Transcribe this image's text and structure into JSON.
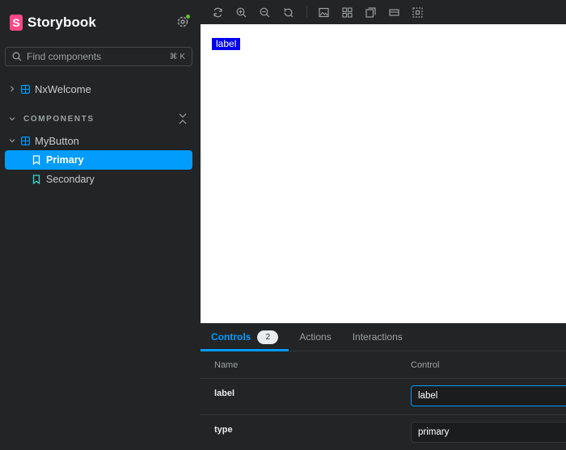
{
  "brand": {
    "name": "Storybook",
    "logo_letter": "S",
    "color": "#ff4785"
  },
  "sidebar": {
    "search_placeholder": "Find components",
    "search_shortcut": "⌘ K",
    "top_item": {
      "label": "NxWelcome"
    },
    "section_label": "COMPONENTS",
    "component": {
      "label": "MyButton"
    },
    "stories": [
      {
        "label": "Primary",
        "selected": true
      },
      {
        "label": "Secondary",
        "selected": false
      }
    ],
    "accent_color": "#029cfd"
  },
  "toolbar": {
    "icons": [
      "reload-icon",
      "zoom-in-icon",
      "zoom-out-icon",
      "zoom-reset-icon",
      "background-icon",
      "grid-icon",
      "viewport-icon",
      "measure-icon",
      "outline-icon"
    ]
  },
  "preview": {
    "button_label": "label"
  },
  "addons": {
    "tabs": [
      {
        "label": "Controls",
        "badge": "2",
        "active": true
      },
      {
        "label": "Actions",
        "active": false
      },
      {
        "label": "Interactions",
        "active": false
      }
    ],
    "table": {
      "col_name": "Name",
      "col_control": "Control",
      "rows": [
        {
          "name": "label",
          "value": "label",
          "focused": true
        },
        {
          "name": "type",
          "value": "primary",
          "focused": false
        }
      ]
    }
  }
}
